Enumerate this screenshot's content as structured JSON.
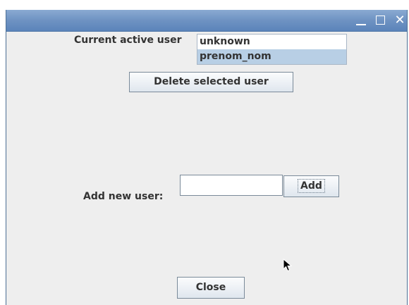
{
  "window": {
    "controls": {
      "close_glyph": "✕"
    }
  },
  "user_panel": {
    "current_user_label": "Current active user",
    "users": [
      {
        "name": "unknown",
        "selected": false
      },
      {
        "name": "prenom_nom",
        "selected": true
      }
    ],
    "delete_button_label": "Delete selected user"
  },
  "add_panel": {
    "label": "Add new user:",
    "input_value": "",
    "add_button_label": "Add"
  },
  "footer": {
    "close_button_label": "Close"
  },
  "colors": {
    "titlebar": "#6e92c2",
    "window_bg": "#eeeeee",
    "selection": "#b8cfe5"
  }
}
